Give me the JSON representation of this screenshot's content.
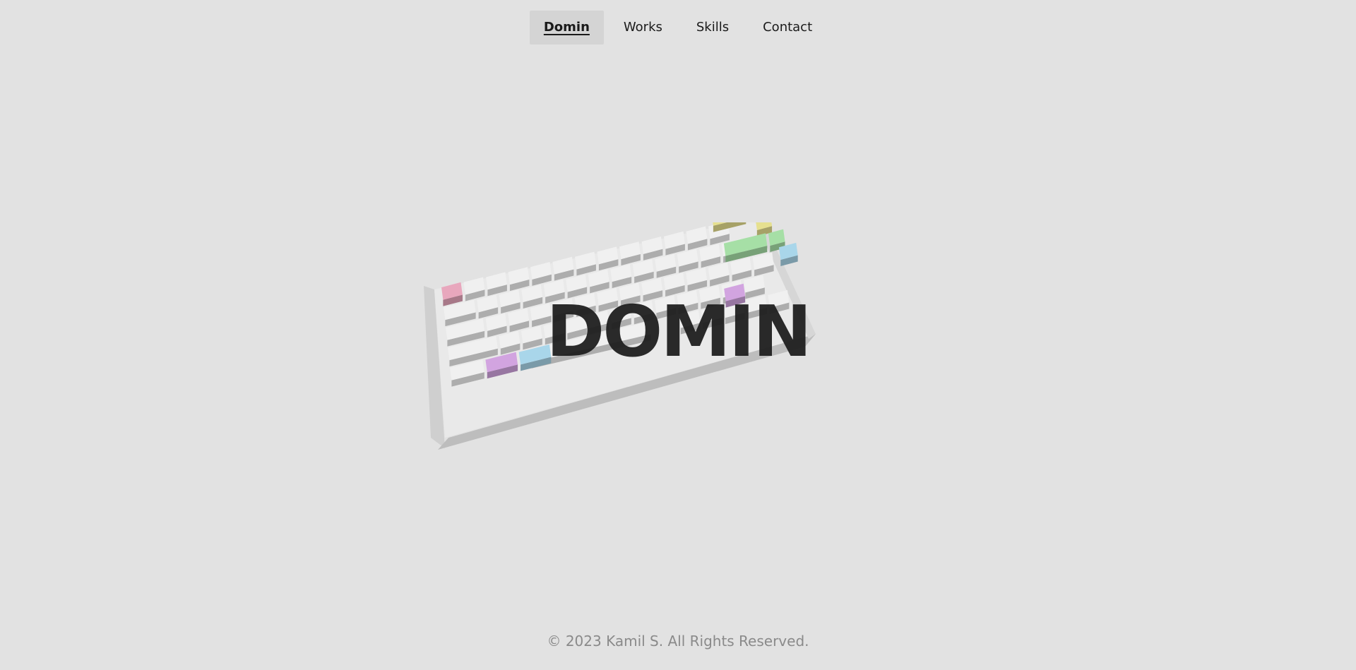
{
  "nav": {
    "items": [
      {
        "label": "Domin",
        "active": true
      },
      {
        "label": "Works",
        "active": false
      },
      {
        "label": "Skills",
        "active": false
      },
      {
        "label": "Contact",
        "active": false
      }
    ]
  },
  "hero": {
    "title": "DOMIN"
  },
  "footer": {
    "text": "© 2023 Kamil S. All Rights Reserved."
  },
  "colors": {
    "background": "#e2e2e2",
    "keycap_white": "#f0f0f0",
    "keycap_pink": "#e8a7bd",
    "keycap_yellow": "#e6e08f",
    "keycap_green": "#a6dfa6",
    "keycap_blue": "#a9d6ea",
    "keycap_purple": "#d2a4e0"
  }
}
